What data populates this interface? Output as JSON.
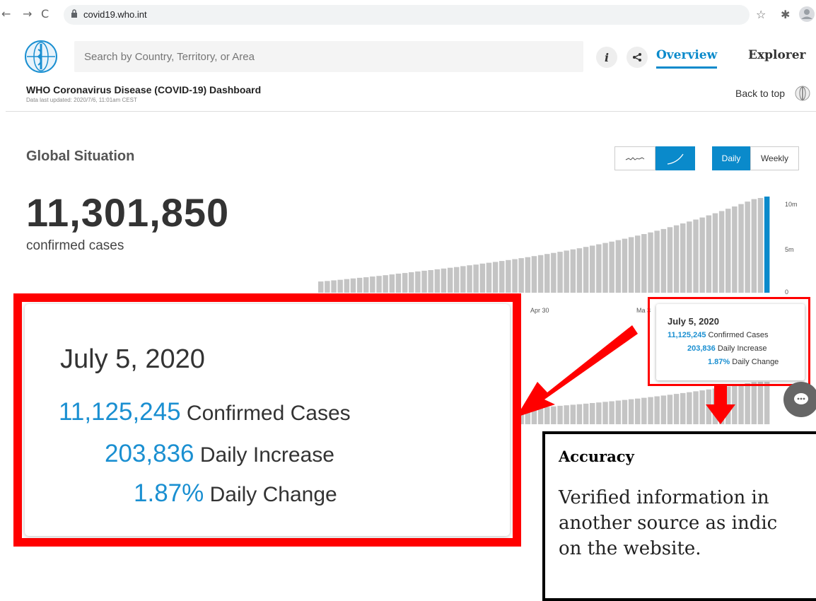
{
  "browser": {
    "url": "covid19.who.int"
  },
  "header": {
    "search_placeholder": "Search by Country, Territory, or Area",
    "nav": {
      "overview": "Overview",
      "explorer": "Explorer"
    },
    "dashboard_title": "WHO Coronavirus Disease (COVID-19) Dashboard",
    "data_updated": "Data last updated: 2020/7/6, 11:01am CEST",
    "back_to_top": "Back to top",
    "accent_color": "#0a8acb"
  },
  "global": {
    "title": "Global Situation",
    "confirmed_number": "11,301,850",
    "confirmed_label": "confirmed cases",
    "toggles": {
      "daily": "Daily",
      "weekly": "Weekly"
    }
  },
  "chart_data": {
    "type": "bar",
    "y_ticks": [
      "10m",
      "5m",
      "0"
    ],
    "x_ticks": [
      "Apr 30",
      "Ma 3"
    ],
    "ylim": [
      0,
      11300000
    ],
    "bar_color": "#c4c4c4",
    "highlight_color": "#0a8acb",
    "values": [
      1.32,
      1.38,
      1.45,
      1.52,
      1.6,
      1.68,
      1.75,
      1.82,
      1.9,
      1.98,
      2.06,
      2.15,
      2.24,
      2.32,
      2.41,
      2.5,
      2.58,
      2.66,
      2.75,
      2.84,
      2.93,
      3.02,
      3.12,
      3.22,
      3.31,
      3.42,
      3.52,
      3.62,
      3.73,
      3.84,
      3.95,
      4.06,
      4.18,
      4.3,
      4.42,
      4.55,
      4.68,
      4.81,
      4.95,
      5.09,
      5.23,
      5.38,
      5.53,
      5.69,
      5.85,
      6.01,
      6.18,
      6.35,
      6.53,
      6.71,
      6.9,
      7.09,
      7.29,
      7.49,
      7.7,
      7.92,
      8.14,
      8.37,
      8.6,
      8.84,
      9.09,
      9.34,
      9.6,
      9.87,
      10.14,
      10.42,
      10.71,
      11.0,
      11.13,
      11.3
    ]
  },
  "tooltip": {
    "date": "July 5, 2020",
    "rows": [
      {
        "value": "11,125,245",
        "label": "Confirmed Cases"
      },
      {
        "value": "203,836",
        "label": "Daily Increase"
      },
      {
        "value": "1.87%",
        "label": "Daily Change"
      }
    ]
  },
  "accuracy": {
    "title": "Accuracy",
    "text": "Verified information in\nanother source as indic\non the website."
  }
}
